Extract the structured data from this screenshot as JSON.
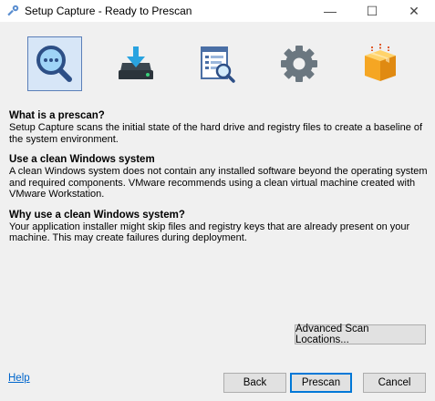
{
  "window": {
    "title": "Setup Capture - Ready to Prescan",
    "minimize": "—",
    "maximize": "☐",
    "close": "✕"
  },
  "steps": [
    {
      "icon": "magnifier-icon",
      "active": true
    },
    {
      "icon": "download-drive-icon",
      "active": false
    },
    {
      "icon": "document-search-icon",
      "active": false
    },
    {
      "icon": "gear-icon",
      "active": false
    },
    {
      "icon": "package-box-icon",
      "active": false
    }
  ],
  "sections": [
    {
      "title": "What is a prescan?",
      "body": "Setup Capture scans the initial state of the hard drive and registry files to create a baseline of the system environment."
    },
    {
      "title": "Use a clean Windows system",
      "body": "A clean Windows system does not contain any installed software beyond the operating system and required components. VMware recommends using a clean virtual machine created with VMware Workstation."
    },
    {
      "title": "Why use a clean Windows system?",
      "body": "Your application installer might skip files and registry keys that are already present on your machine. This may create failures during deployment."
    }
  ],
  "buttons": {
    "advanced": "Advanced Scan Locations...",
    "back": "Back",
    "prescan": "Prescan",
    "cancel": "Cancel",
    "help": "Help"
  },
  "colors": {
    "accent": "#0078d7",
    "active_step_bg": "#d7e6f7",
    "link": "#0066cc"
  }
}
